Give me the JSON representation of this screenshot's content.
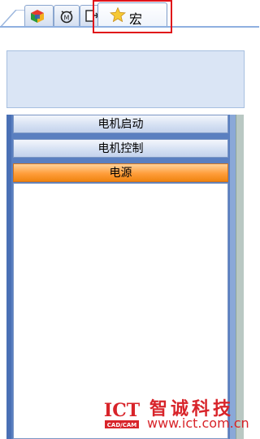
{
  "tabs": [
    {
      "icon": "cube-palette-icon"
    },
    {
      "icon": "motor-icon"
    },
    {
      "icon": "document-arrow-icon"
    },
    {
      "icon": "star-icon",
      "label": "宏",
      "active": true
    }
  ],
  "panel_sections": [
    {
      "label": "电机启动",
      "active": false
    },
    {
      "label": "电机控制",
      "active": false
    },
    {
      "label": "电源",
      "active": true
    }
  ],
  "watermark": {
    "logo_text": "ICT",
    "logo_sub": "CAD/CAM",
    "title": "智诚科技",
    "url": "www.ict.com.cn"
  },
  "colors": {
    "highlight": "#e0141a",
    "active_section": "#ff9d3a",
    "brand_red": "#d8242a"
  }
}
